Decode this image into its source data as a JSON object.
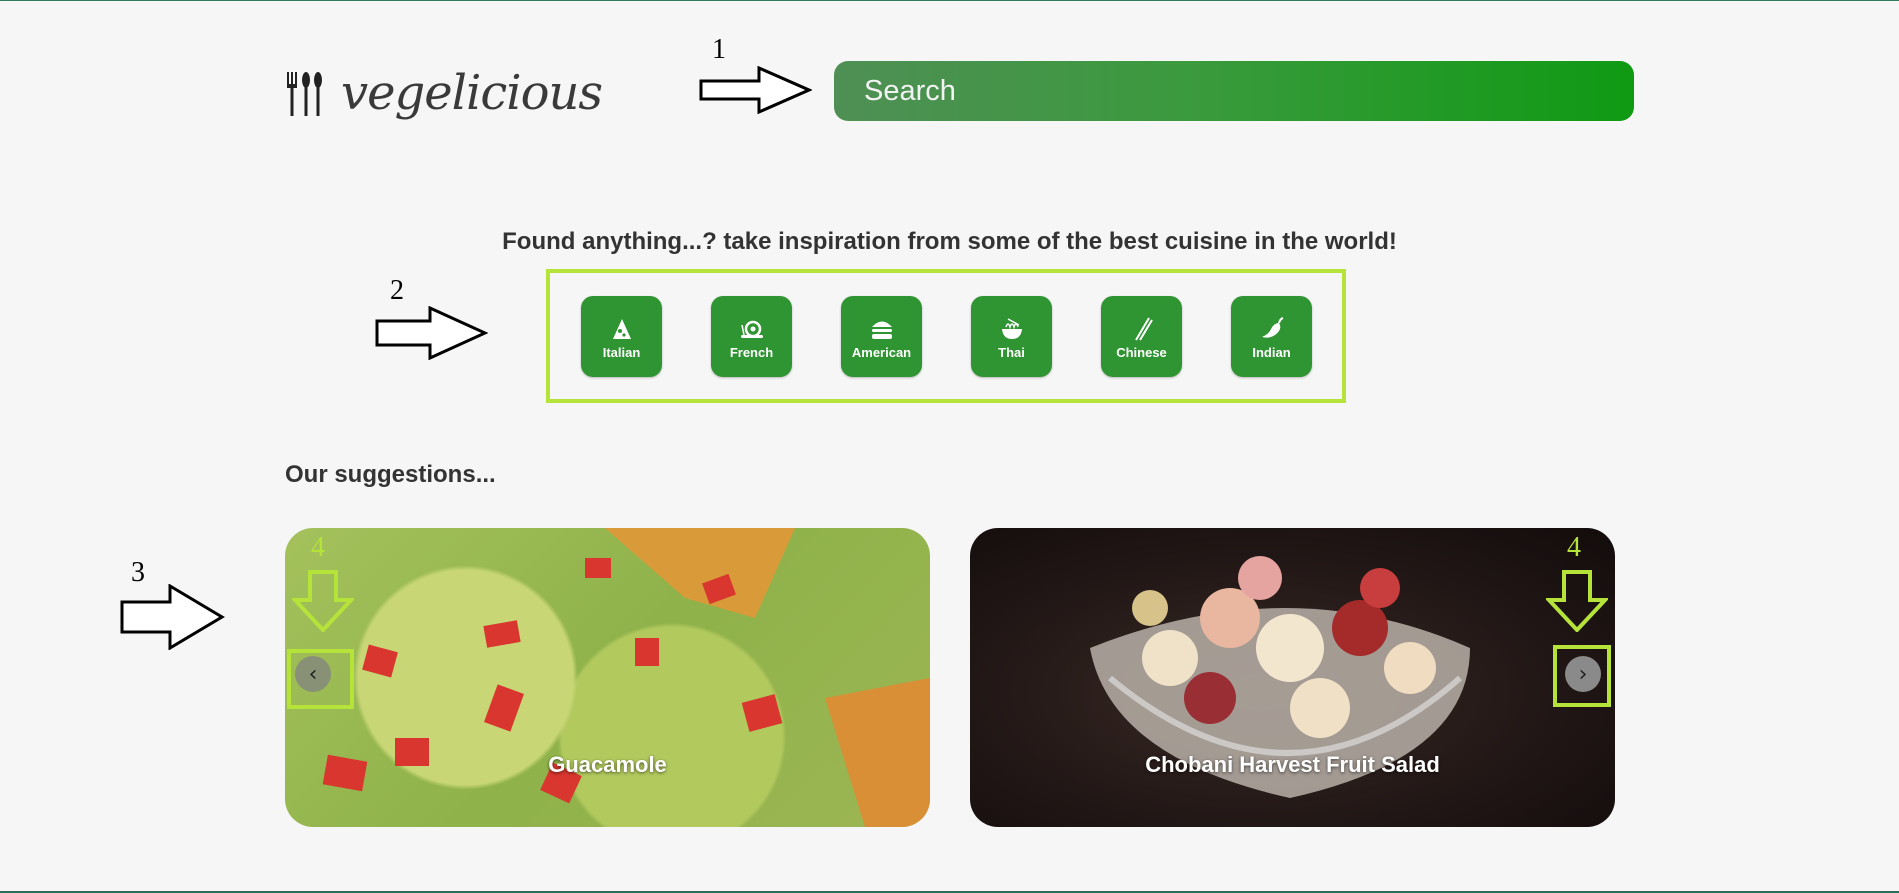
{
  "logo": {
    "text": "vegelicious",
    "icon": "utensils-icon"
  },
  "search": {
    "placeholder": "Search"
  },
  "tagline": "Found anything...? take inspiration from some of the best cuisine in the world!",
  "cuisines": [
    {
      "label": "Italian",
      "icon": "pizza-icon"
    },
    {
      "label": "French",
      "icon": "snail-icon"
    },
    {
      "label": "American",
      "icon": "burger-icon"
    },
    {
      "label": "Thai",
      "icon": "noodle-bowl-icon"
    },
    {
      "label": "Chinese",
      "icon": "chopsticks-icon"
    },
    {
      "label": "Indian",
      "icon": "chili-pepper-icon"
    }
  ],
  "suggestions": {
    "heading": "Our suggestions...",
    "cards": [
      {
        "title": "Guacamole"
      },
      {
        "title": "Chobani Harvest Fruit Salad"
      }
    ]
  },
  "annotations": {
    "n1": "1",
    "n2": "2",
    "n3": "3",
    "n4a": "4",
    "n4b": "4"
  },
  "colors": {
    "accent_green": "#2f9432",
    "highlight": "#b5e33a"
  }
}
